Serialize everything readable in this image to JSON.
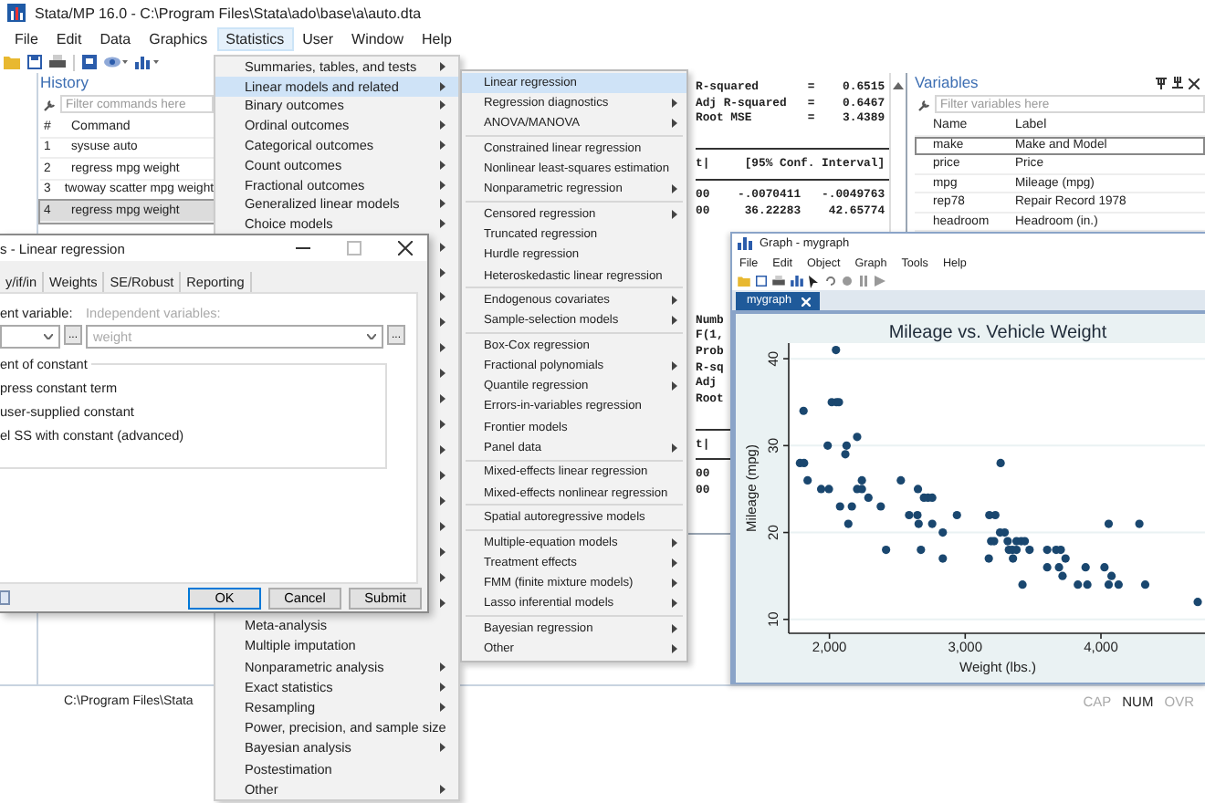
{
  "main_window": {
    "title": "Stata/MP 16.0 - C:\\Program Files\\Stata\\ado\\base\\a\\auto.dta",
    "menu": [
      {
        "label": "File",
        "selected": false
      },
      {
        "label": "Edit",
        "selected": false
      },
      {
        "label": "Data",
        "selected": false
      },
      {
        "label": "Graphics",
        "selected": false
      },
      {
        "label": "Statistics",
        "selected": true
      },
      {
        "label": "User",
        "selected": false
      },
      {
        "label": "Window",
        "selected": false
      },
      {
        "label": "Help",
        "selected": false
      }
    ],
    "history": {
      "title": "History",
      "placeholder": "Filter commands here",
      "columns": [
        "#",
        "Command"
      ],
      "rows": [
        {
          "num": "1",
          "command": "sysuse auto",
          "selected": false
        },
        {
          "num": "2",
          "command": "regress mpg weight",
          "selected": false
        },
        {
          "num": "3",
          "command": "twoway scatter mpg weight",
          "selected": false
        },
        {
          "num": "4",
          "command": "regress mpg weight",
          "selected": true
        }
      ]
    },
    "results": {
      "lines": [
        {
          "kind": "text",
          "text": "R-squared       =    0.6515"
        },
        {
          "kind": "text",
          "text": "Adj R-squared   =    0.6467"
        },
        {
          "kind": "text",
          "text": "Root MSE        =    3.4389"
        },
        {
          "kind": "blank"
        },
        {
          "kind": "rule"
        },
        {
          "kind": "text",
          "text": "t|     [95% Conf. Interval]"
        },
        {
          "kind": "rule"
        },
        {
          "kind": "text",
          "text": "00    -.0070411   -.0049763"
        },
        {
          "kind": "text",
          "text": "00     36.22283    42.65774"
        },
        {
          "kind": "blank"
        },
        {
          "kind": "blank"
        },
        {
          "kind": "blank"
        },
        {
          "kind": "blank"
        },
        {
          "kind": "blank"
        },
        {
          "kind": "blank"
        },
        {
          "kind": "text",
          "text": "Numb"
        },
        {
          "kind": "text",
          "text": "F(1,"
        },
        {
          "kind": "text",
          "text": "Prob"
        },
        {
          "kind": "text",
          "text": "R-sq"
        },
        {
          "kind": "text",
          "text": "Adj"
        },
        {
          "kind": "text",
          "text": "Root"
        },
        {
          "kind": "blank"
        },
        {
          "kind": "rule"
        },
        {
          "kind": "text",
          "text": "t|"
        },
        {
          "kind": "rule"
        },
        {
          "kind": "text",
          "text": "00"
        },
        {
          "kind": "text",
          "text": "00"
        }
      ]
    },
    "variables": {
      "title": "Variables",
      "placeholder": "Filter variables here",
      "columns": [
        "Name",
        "Label"
      ],
      "rows": [
        {
          "name": "make",
          "label": "Make and Model",
          "selected": true
        },
        {
          "name": "price",
          "label": "Price",
          "selected": false
        },
        {
          "name": "mpg",
          "label": "Mileage (mpg)",
          "selected": false
        },
        {
          "name": "rep78",
          "label": "Repair Record 1978",
          "selected": false
        },
        {
          "name": "headroom",
          "label": "Headroom (in.)",
          "selected": false
        }
      ]
    },
    "status_bar": {
      "path": "C:\\Program Files\\Stata",
      "indicators": [
        {
          "label": "CAP",
          "on": false
        },
        {
          "label": "NUM",
          "on": true
        },
        {
          "label": "OVR",
          "on": false
        }
      ]
    }
  },
  "statistics_menu": {
    "top_items": [
      {
        "label": "Summaries, tables, and tests",
        "submenu": true,
        "selected": false
      },
      {
        "label": "Linear models and related",
        "submenu": true,
        "selected": true
      },
      {
        "label": "Binary outcomes",
        "submenu": true,
        "selected": false
      },
      {
        "label": "Ordinal outcomes",
        "submenu": true,
        "selected": false
      },
      {
        "label": "Categorical outcomes",
        "submenu": true,
        "selected": false
      },
      {
        "label": "Count outcomes",
        "submenu": true,
        "selected": false
      },
      {
        "label": "Fractional outcomes",
        "submenu": true,
        "selected": false
      },
      {
        "label": "Generalized linear models",
        "submenu": true,
        "selected": false
      },
      {
        "label": "Choice models",
        "submenu": true,
        "selected": false
      }
    ],
    "bottom_items": [
      {
        "label": "Meta-analysis",
        "submenu": false,
        "selected": false
      },
      {
        "label": "Multiple imputation",
        "submenu": false,
        "selected": false
      },
      {
        "label": "Nonparametric analysis",
        "submenu": true,
        "selected": false
      },
      {
        "label": "Exact statistics",
        "submenu": true,
        "selected": false
      },
      {
        "label": "Resampling",
        "submenu": true,
        "selected": false
      },
      {
        "label": "Power, precision, and sample size",
        "submenu": false,
        "selected": false
      },
      {
        "label": "Bayesian analysis",
        "submenu": true,
        "selected": false
      },
      {
        "label": "Postestimation",
        "submenu": false,
        "selected": false
      },
      {
        "label": "Other",
        "submenu": true,
        "selected": false
      }
    ]
  },
  "linear_models_submenu": {
    "groups": [
      [
        {
          "label": "Linear regression",
          "submenu": false,
          "selected": true
        },
        {
          "label": "Regression diagnostics",
          "submenu": true,
          "selected": false
        },
        {
          "label": "ANOVA/MANOVA",
          "submenu": true,
          "selected": false
        }
      ],
      [
        {
          "label": "Constrained linear regression",
          "submenu": false,
          "selected": false
        },
        {
          "label": "Nonlinear least-squares estimation",
          "submenu": false,
          "selected": false
        },
        {
          "label": "Nonparametric regression",
          "submenu": true,
          "selected": false
        }
      ],
      [
        {
          "label": "Censored regression",
          "submenu": true,
          "selected": false
        },
        {
          "label": "Truncated regression",
          "submenu": false,
          "selected": false
        },
        {
          "label": "Hurdle regression",
          "submenu": false,
          "selected": false
        },
        {
          "label": "Heteroskedastic linear regression",
          "submenu": false,
          "selected": false
        }
      ],
      [
        {
          "label": "Endogenous covariates",
          "submenu": true,
          "selected": false
        },
        {
          "label": "Sample-selection models",
          "submenu": true,
          "selected": false
        }
      ],
      [
        {
          "label": "Box-Cox regression",
          "submenu": false,
          "selected": false
        },
        {
          "label": "Fractional polynomials",
          "submenu": true,
          "selected": false
        },
        {
          "label": "Quantile regression",
          "submenu": true,
          "selected": false
        },
        {
          "label": "Errors-in-variables regression",
          "submenu": false,
          "selected": false
        },
        {
          "label": "Frontier models",
          "submenu": false,
          "selected": false
        },
        {
          "label": "Panel data",
          "submenu": true,
          "selected": false
        }
      ],
      [
        {
          "label": "Mixed-effects linear regression",
          "submenu": false,
          "selected": false
        },
        {
          "label": "Mixed-effects nonlinear regression",
          "submenu": false,
          "selected": false
        }
      ],
      [
        {
          "label": "Spatial autoregressive models",
          "submenu": false,
          "selected": false
        }
      ],
      [
        {
          "label": "Multiple-equation models",
          "submenu": true,
          "selected": false
        },
        {
          "label": "Treatment effects",
          "submenu": true,
          "selected": false
        },
        {
          "label": "FMM (finite mixture models)",
          "submenu": true,
          "selected": false
        },
        {
          "label": "Lasso inferential models",
          "submenu": true,
          "selected": false
        }
      ],
      [
        {
          "label": "Bayesian regression",
          "submenu": true,
          "selected": false
        },
        {
          "label": "Other",
          "submenu": true,
          "selected": false
        }
      ]
    ]
  },
  "dialog": {
    "title": "s - Linear regression",
    "tabs": [
      {
        "label": "y/if/in",
        "selected": false
      },
      {
        "label": "Weights",
        "selected": false
      },
      {
        "label": "SE/Robust",
        "selected": false
      },
      {
        "label": "Reporting",
        "selected": false
      }
    ],
    "dependent": {
      "label": "ent variable:",
      "browse": "..."
    },
    "independent": {
      "label": "Independent variables:",
      "value": "weight",
      "browse": "..."
    },
    "constant_group": {
      "title": "ent of constant",
      "options": [
        "press constant term",
        "user-supplied constant",
        "el SS with constant (advanced)"
      ]
    },
    "buttons": [
      {
        "label": "OK",
        "default": true
      },
      {
        "label": "Cancel",
        "default": false
      },
      {
        "label": "Submit",
        "default": false
      }
    ]
  },
  "graph_window": {
    "title": "Graph - mygraph",
    "menu": [
      "File",
      "Edit",
      "Object",
      "Graph",
      "Tools",
      "Help"
    ],
    "tab": "mygraph",
    "chart_data": {
      "type": "scatter",
      "title": "Mileage vs. Vehicle Weight",
      "xlabel": "Weight (lbs.)",
      "ylabel": "Mileage (mpg)",
      "x": [
        2048,
        1783,
        1813,
        1809,
        1839,
        2017,
        2052,
        2070,
        1987,
        1939,
        1996,
        2204,
        2126,
        2117,
        2078,
        2139,
        2165,
        2204,
        2239,
        2239,
        2287,
        2378,
        2417,
        2526,
        2587,
        2648,
        2652,
        2657,
        2674,
        2696,
        2726,
        2757,
        2757,
        2835,
        2835,
        2939,
        3261,
        3178,
        3222,
        3191,
        3213,
        3257,
        3291,
        3313,
        3174,
        3322,
        3348,
        3352,
        3378,
        3413,
        3439,
        3378,
        3422,
        3474,
        3604,
        3604,
        3670,
        3704,
        3691,
        3717,
        3739,
        3830,
        3900,
        3887,
        4026,
        4057,
        4057,
        4078,
        4130,
        4283,
        4326,
        4713
      ],
      "series": [
        {
          "color": "#1a476f",
          "values": [
            41,
            28,
            28,
            34,
            26,
            35,
            35,
            35,
            30,
            25,
            25,
            31,
            30,
            29,
            23,
            21,
            23,
            25,
            25,
            26,
            24,
            23,
            18,
            26,
            22,
            22,
            25,
            21,
            18,
            24,
            24,
            24,
            21,
            20,
            17,
            22,
            28,
            22,
            22,
            19,
            19,
            20,
            20,
            19,
            17,
            18,
            18,
            17,
            19,
            19,
            19,
            18,
            14,
            18,
            18,
            16,
            18,
            18,
            16,
            15,
            17,
            14,
            14,
            16,
            16,
            21,
            14,
            15,
            14,
            21,
            14,
            12
          ]
        }
      ],
      "grid": true,
      "xlim": [
        1700,
        4780
      ],
      "ylim": [
        8.4,
        41.8
      ],
      "xticks": [
        {
          "value": 2000,
          "label": "2,000"
        },
        {
          "value": 3000,
          "label": "3,000"
        },
        {
          "value": 4000,
          "label": "4,000"
        }
      ],
      "yticks": [
        10,
        20,
        30,
        40
      ]
    }
  }
}
